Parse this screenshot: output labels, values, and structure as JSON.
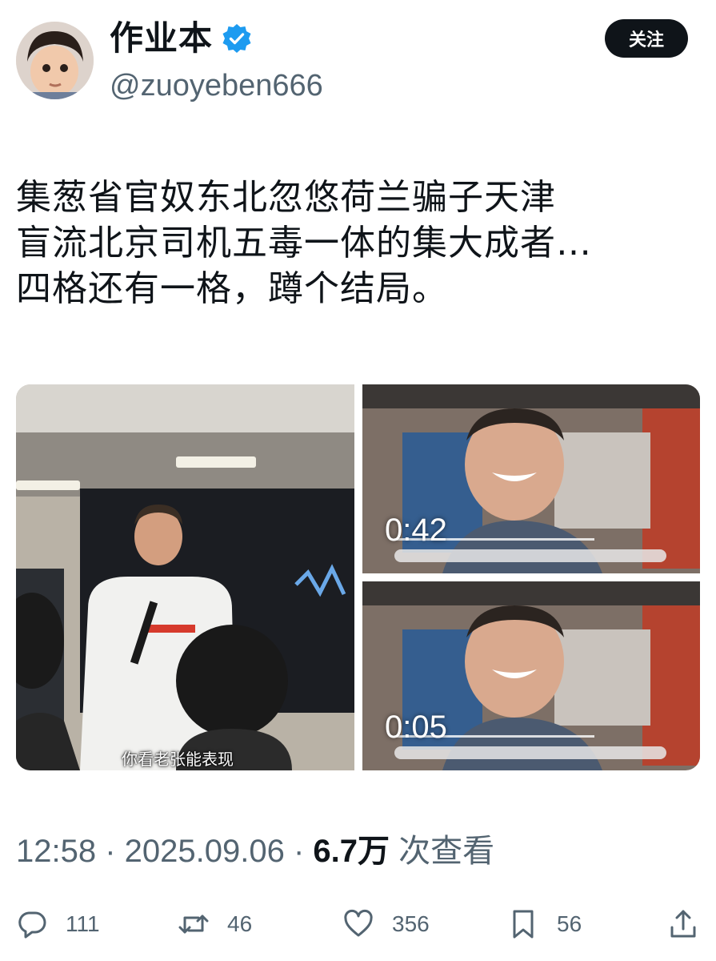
{
  "author": {
    "display_name": "作业本",
    "handle": "@zuoyeben666",
    "verified_icon": "verified-badge-icon",
    "follow_label": "关注"
  },
  "tweet": {
    "lines": [
      "集葱省官奴东北忽悠荷兰骗子天津",
      "盲流北京司机五毒一体的集大成者…",
      "四格还有一格，蹲个结局。"
    ]
  },
  "media": {
    "photo_subtitle": "你看老张能表现",
    "videos": [
      {
        "duration": "0:42"
      },
      {
        "duration": "0:05"
      }
    ]
  },
  "meta": {
    "time": "12:58",
    "sep1": " · ",
    "date": "2025.09.06",
    "sep2": " · ",
    "views": "6.7万",
    "views_suffix": " 次查看"
  },
  "actions": {
    "replies": "111",
    "retweets": "46",
    "likes": "356",
    "bookmarks": "56"
  },
  "colors": {
    "text": "#0f1419",
    "muted": "#536471",
    "verified": "#1d9bf0",
    "follow_bg": "#0f1419"
  }
}
